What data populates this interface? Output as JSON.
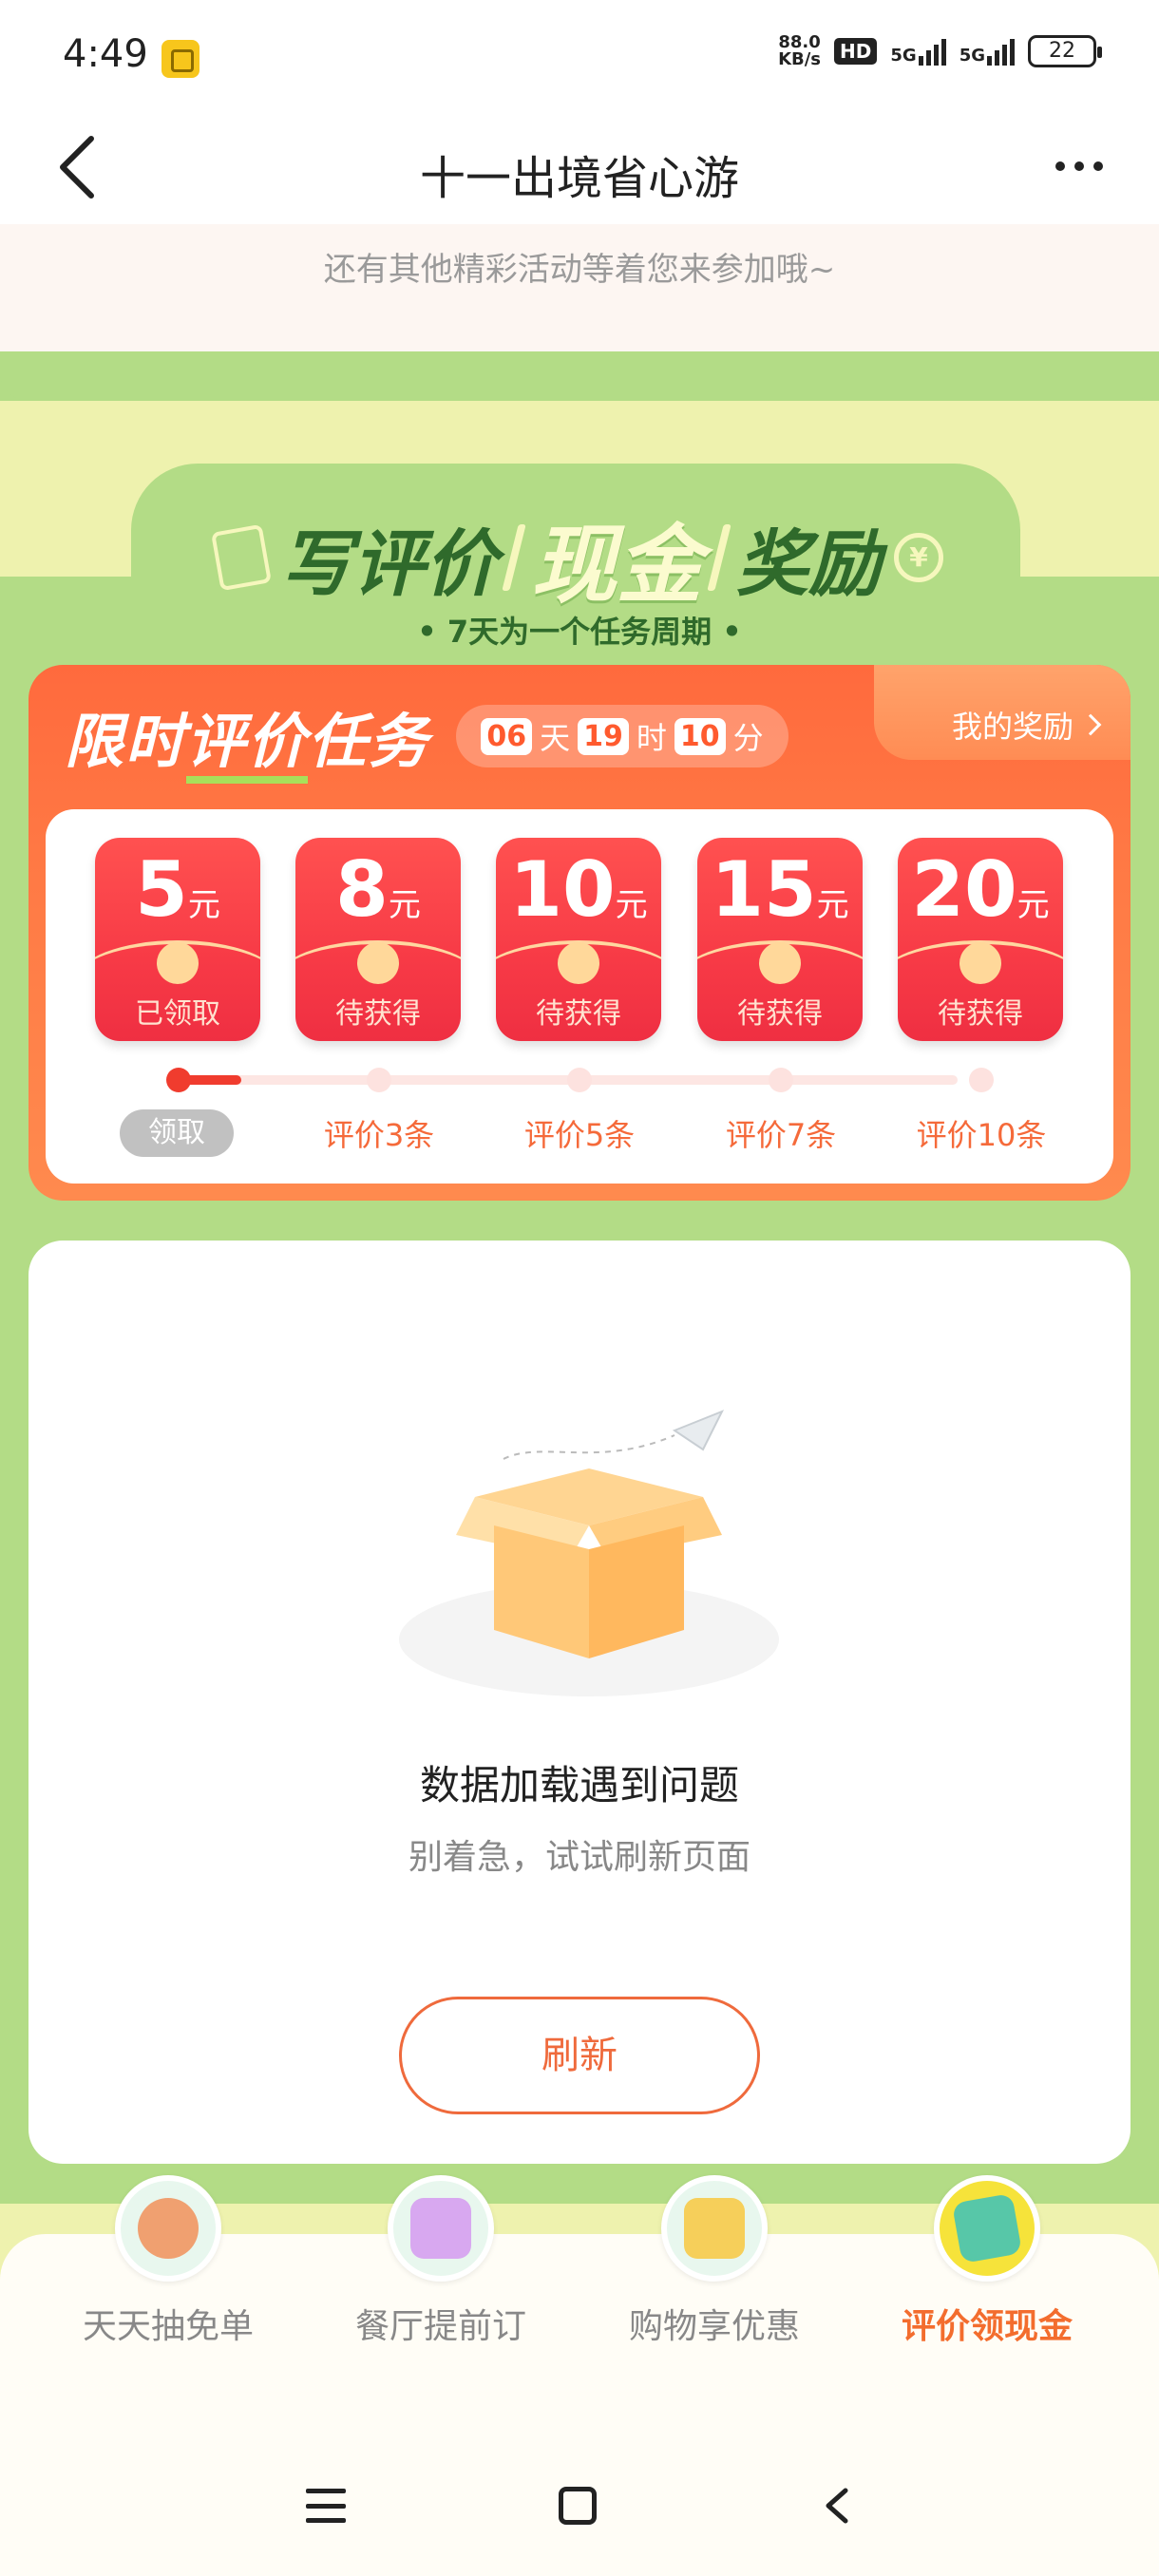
{
  "status_bar": {
    "time": "4:49",
    "net_speed_value": "88.0",
    "net_speed_unit": "KB/s",
    "hd_badge": "HD",
    "network_1": "5G",
    "network_2": "5G",
    "battery": "22"
  },
  "nav": {
    "title": "十一出境省心游"
  },
  "top_card": {
    "text": "还有其他精彩活动等着您来参加哦~"
  },
  "header": {
    "title_left": "写评价",
    "title_highlight": "现金",
    "title_right": "奖励",
    "subtitle": "• 7天为一个任务周期 •"
  },
  "task": {
    "title_part1": "限时",
    "title_part2": "评价",
    "title_part3": "任务",
    "countdown": {
      "days": "06",
      "days_unit": "天",
      "hours": "19",
      "hours_unit": "时",
      "minutes": "10",
      "minutes_unit": "分"
    },
    "my_reward": "我的奖励",
    "rewards": [
      {
        "amount": "5",
        "unit": "元",
        "status": "已领取"
      },
      {
        "amount": "8",
        "unit": "元",
        "status": "待获得"
      },
      {
        "amount": "10",
        "unit": "元",
        "status": "待获得"
      },
      {
        "amount": "15",
        "unit": "元",
        "status": "待获得"
      },
      {
        "amount": "20",
        "unit": "元",
        "status": "待获得"
      }
    ],
    "progress_fraction": 0.08,
    "claim_button": "领取",
    "milestones": [
      "评价3条",
      "评价5条",
      "评价7条",
      "评价10条"
    ]
  },
  "error": {
    "title": "数据加载遇到问题",
    "subtitle": "别着急，试试刷新页面",
    "refresh_button": "刷新"
  },
  "tabs": [
    {
      "label": "天天抽免单",
      "icon": "bear-icon",
      "active": false
    },
    {
      "label": "餐厅提前订",
      "icon": "sofa-icon",
      "active": false
    },
    {
      "label": "购物享优惠",
      "icon": "shopping-bag-icon",
      "active": false
    },
    {
      "label": "评价领现金",
      "icon": "notepad-icon",
      "active": true
    }
  ],
  "colors": {
    "page_green": "#b3dc86",
    "accent_orange": "#f36d2e",
    "task_red": "#ff6a3d"
  }
}
